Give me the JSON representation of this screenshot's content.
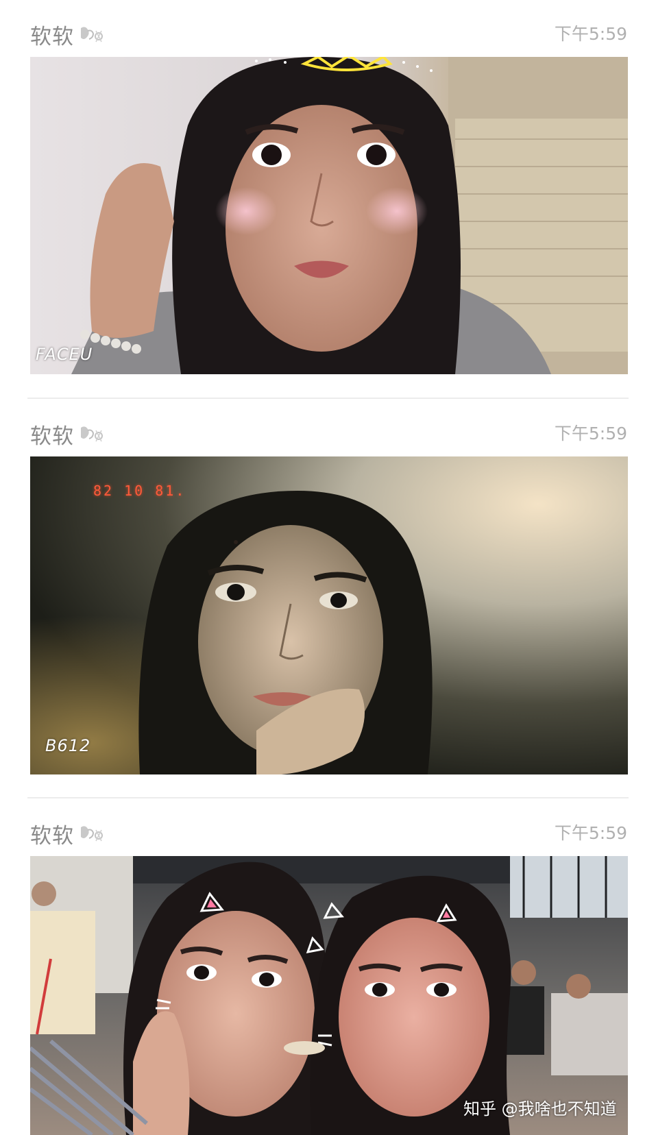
{
  "posts": [
    {
      "author": "软软",
      "time": "下午5:59",
      "photo": {
        "description_icon": "selfie-photo",
        "watermark": "FACEU",
        "date_stamp": ""
      }
    },
    {
      "author": "软软",
      "time": "下午5:59",
      "photo": {
        "description_icon": "selfie-photo",
        "watermark": "B612",
        "date_stamp": "82 10 81."
      }
    },
    {
      "author": "软软",
      "time": "下午5:59",
      "photo": {
        "description_icon": "selfie-photo",
        "watermark": "",
        "date_stamp": ""
      }
    }
  ],
  "footer_watermark": "知乎 @我啥也不知道",
  "colors": {
    "author_text": "#8a8a8a",
    "time_text": "#b0b0b0",
    "divider": "#ececec",
    "date_stamp": "#ff5a3a"
  }
}
